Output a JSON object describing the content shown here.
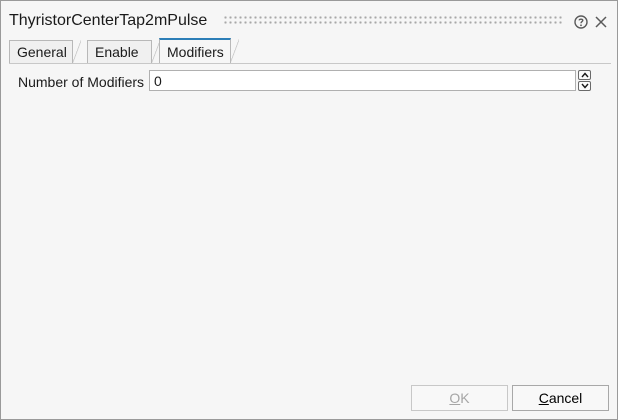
{
  "window": {
    "title": "ThyristorCenterTap2mPulse"
  },
  "tabs": [
    {
      "label": "General",
      "active": false
    },
    {
      "label": "Enable",
      "active": false
    },
    {
      "label": "Modifiers",
      "active": true
    }
  ],
  "form": {
    "number_of_modifiers_label": "Number of Modifiers",
    "number_of_modifiers_value": "0"
  },
  "buttons": {
    "ok_mnemonic": "O",
    "ok_rest": "K",
    "cancel_mnemonic": "C",
    "cancel_rest": "ancel"
  },
  "colors": {
    "active_tab_accent": "#2d7fb8",
    "background": "#f6f6f6"
  }
}
